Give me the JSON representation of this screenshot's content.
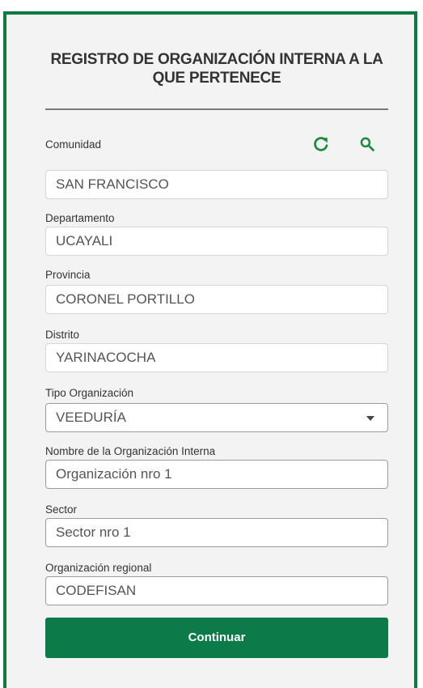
{
  "form": {
    "title": "REGISTRO DE ORGANIZACIÓN INTERNA A LA QUE PERTENECE",
    "fields": [
      {
        "label": "Comunidad",
        "value": "SAN FRANCISCO"
      },
      {
        "label": "Departamento",
        "value": "UCAYALI"
      },
      {
        "label": "Provincia",
        "value": "CORONEL PORTILLO"
      },
      {
        "label": "Distrito",
        "value": "YARINACOCHA"
      },
      {
        "label": "Tipo Organización",
        "value": "VEEDURÍA"
      },
      {
        "label": "Nombre de la Organización Interna",
        "value": "Organización nro 1"
      },
      {
        "label": "Sector",
        "value": "Sector nro 1"
      },
      {
        "label": "Organización regional",
        "value": "CODEFISAN"
      }
    ],
    "continue_label": "Continuar"
  },
  "icons": {
    "refresh": "refresh-icon",
    "search": "search-icon"
  },
  "colors": {
    "accent": "#0d7a4a",
    "frame": "#0d7a3f",
    "background": "#f3f3f3"
  }
}
